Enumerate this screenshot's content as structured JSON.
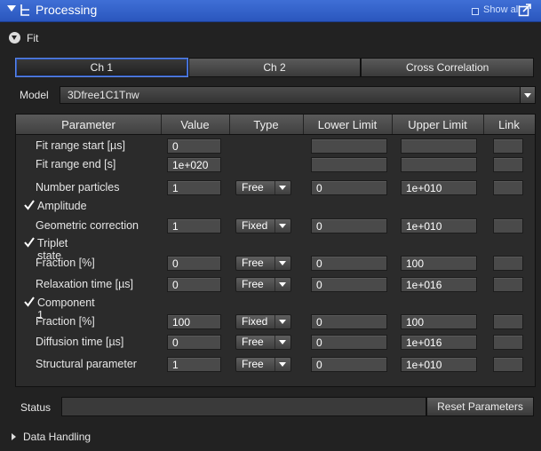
{
  "panel": {
    "title": "Processing",
    "show_all_label": "Show all"
  },
  "fit_section": {
    "label": "Fit"
  },
  "tabs": [
    {
      "label": "Ch 1",
      "active": true
    },
    {
      "label": "Ch 2",
      "active": false
    },
    {
      "label": "Cross Correlation",
      "active": false
    }
  ],
  "model": {
    "label": "Model",
    "value": "3Dfree1C1Tnw"
  },
  "table": {
    "headers": [
      "Parameter",
      "Value",
      "Type",
      "Lower Limit",
      "Upper Limit",
      "Link"
    ],
    "rows": [
      {
        "kind": "param",
        "name": "Fit range start [µs]",
        "value": "0",
        "type": null,
        "lower": "",
        "upper": ""
      },
      {
        "kind": "param",
        "name": "Fit range end [s]",
        "value": "1e+020",
        "type": null,
        "lower": "",
        "upper": ""
      },
      {
        "kind": "param",
        "name": "Number particles",
        "value": "1",
        "type": "Free",
        "lower": "0",
        "upper": "1e+010"
      },
      {
        "kind": "group",
        "name": "Amplitude",
        "checked": true
      },
      {
        "kind": "param",
        "name": "Geometric correction",
        "value": "1",
        "type": "Fixed",
        "lower": "0",
        "upper": "1e+010"
      },
      {
        "kind": "group",
        "name": "Triplet state",
        "checked": true
      },
      {
        "kind": "param",
        "name": "Fraction [%]",
        "value": "0",
        "type": "Free",
        "lower": "0",
        "upper": "100"
      },
      {
        "kind": "param",
        "name": "Relaxation time [µs]",
        "value": "0",
        "type": "Free",
        "lower": "0",
        "upper": "1e+016"
      },
      {
        "kind": "group",
        "name": "Component 1",
        "checked": true
      },
      {
        "kind": "param",
        "name": "Fraction [%]",
        "value": "100",
        "type": "Fixed",
        "lower": "0",
        "upper": "100"
      },
      {
        "kind": "param",
        "name": "Diffusion time [µs]",
        "value": "0",
        "type": "Free",
        "lower": "0",
        "upper": "1e+016"
      },
      {
        "kind": "param",
        "name": "Structural parameter",
        "value": "1",
        "type": "Free",
        "lower": "0",
        "upper": "1e+010"
      }
    ]
  },
  "status": {
    "label": "Status",
    "value": "",
    "reset_label": "Reset Parameters"
  },
  "data_handling": {
    "label": "Data Handling"
  }
}
